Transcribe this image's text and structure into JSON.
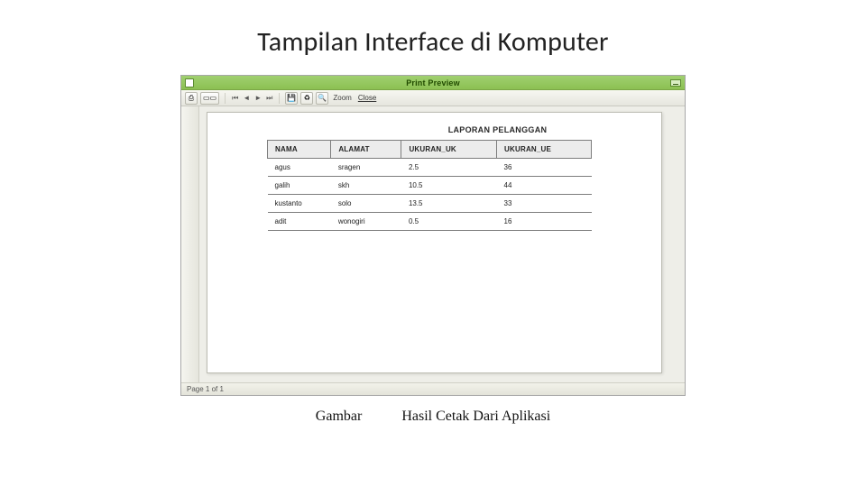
{
  "slide_title": "Tampilan Interface di Komputer",
  "window": {
    "title": "Print Preview",
    "zoom_label": "Zoom",
    "close_label": "Close",
    "status": "Page 1 of 1"
  },
  "report": {
    "title": "LAPORAN PELANGGAN",
    "columns": [
      "NAMA",
      "ALAMAT",
      "UKURAN_UK",
      "UKURAN_UE"
    ],
    "rows": [
      {
        "nama": "agus",
        "alamat": "sragen",
        "uk": "2.5",
        "ue": "36"
      },
      {
        "nama": "galih",
        "alamat": "skh",
        "uk": "10.5",
        "ue": "44"
      },
      {
        "nama": "kustanto",
        "alamat": "solo",
        "uk": "13.5",
        "ue": "33"
      },
      {
        "nama": "adit",
        "alamat": "wonogiri",
        "uk": "0.5",
        "ue": "16"
      }
    ]
  },
  "caption_left": "Gambar",
  "caption_right": "Hasil Cetak Dari Aplikasi"
}
